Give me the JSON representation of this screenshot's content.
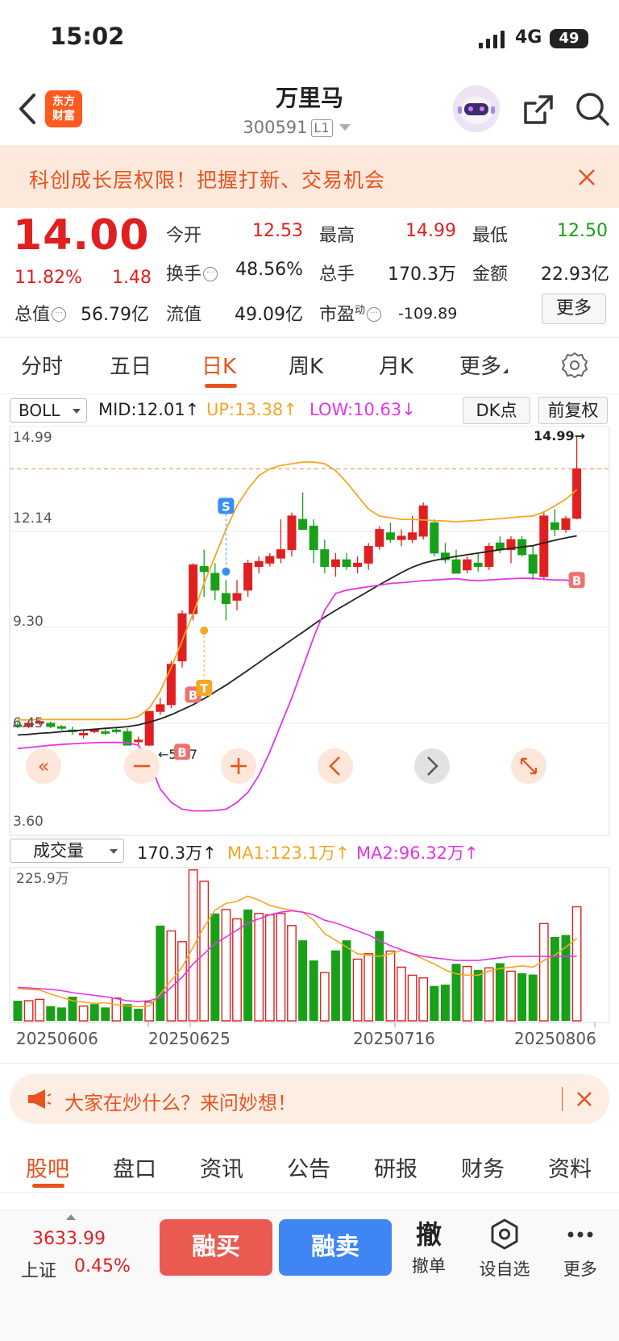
{
  "status_bar": {
    "time": "15:02",
    "network": "4G",
    "battery": "49"
  },
  "header": {
    "logo_text": [
      "东方",
      "财富"
    ],
    "stock_name": "万里马",
    "stock_code": "300591",
    "level_badge": "L1"
  },
  "promo": {
    "text": "科创成长层权限！把握打新、交易机会"
  },
  "quote": {
    "price": "14.00",
    "change_pct": "11.82%",
    "change_amt": "1.48",
    "open_label": "今开",
    "open": "12.53",
    "high_label": "最高",
    "high": "14.99",
    "low_label": "最低",
    "low": "12.50",
    "turnover_label": "换手",
    "turnover": "48.56%",
    "volume_label": "总手",
    "volume": "170.3万",
    "amount_label": "金额",
    "amount": "22.93亿",
    "total_cap_label": "总值",
    "total_cap": "56.79亿",
    "float_cap_label": "流值",
    "float_cap": "49.09亿",
    "pe_label": "市盈",
    "pe_sup": "动",
    "pe": "-109.89",
    "more_label": "更多"
  },
  "period_tabs": [
    "分时",
    "五日",
    "日K",
    "周K",
    "月K",
    "更多"
  ],
  "indicator": {
    "name": "BOLL",
    "mid": "MID:12.01↑",
    "up": "UP:13.38↑",
    "low": "LOW:10.63↓",
    "dk_label": "DK点",
    "adjust_label": "前复权"
  },
  "colors": {
    "up": "#e02020",
    "down": "#19a019",
    "boll_mid": "#222222",
    "boll_up": "#f5a623",
    "boll_low": "#e535e5",
    "accent": "#e8531f"
  },
  "chart_data": [
    {
      "type": "candlestick",
      "y_axis_labels": [
        "14.99",
        "12.14",
        "9.30",
        "6.45",
        "3.60"
      ],
      "ylim": [
        3.6,
        14.99
      ],
      "high_marker": "14.99",
      "low_marker": "5.77",
      "signals": [
        "S",
        "B",
        "T",
        "B",
        "B"
      ],
      "candles": [
        [
          6.4,
          6.48,
          6.3,
          6.35
        ],
        [
          6.35,
          6.55,
          6.3,
          6.45
        ],
        [
          6.45,
          6.55,
          6.4,
          6.5
        ],
        [
          6.45,
          6.5,
          6.3,
          6.35
        ],
        [
          6.35,
          6.4,
          6.25,
          6.3
        ],
        [
          6.25,
          6.35,
          6.1,
          6.2
        ],
        [
          6.1,
          6.25,
          6.0,
          6.15
        ],
        [
          6.2,
          6.3,
          6.15,
          6.25
        ],
        [
          6.2,
          6.3,
          6.1,
          6.15
        ],
        [
          6.25,
          6.3,
          6.15,
          6.2
        ],
        [
          6.2,
          6.3,
          5.9,
          5.8
        ],
        [
          5.9,
          6.05,
          5.8,
          5.95
        ],
        [
          5.8,
          6.8,
          5.77,
          6.8
        ],
        [
          6.8,
          7.2,
          6.7,
          7.0
        ],
        [
          7.0,
          8.3,
          6.9,
          8.2
        ],
        [
          8.3,
          9.8,
          8.1,
          9.7
        ],
        [
          9.7,
          11.2,
          9.5,
          11.15
        ],
        [
          11.1,
          11.6,
          10.2,
          10.95
        ],
        [
          10.9,
          11.2,
          10.1,
          10.4
        ],
        [
          10.3,
          10.7,
          9.5,
          10.0
        ],
        [
          10.1,
          10.7,
          9.8,
          10.3
        ],
        [
          10.4,
          11.3,
          10.2,
          11.2
        ],
        [
          11.1,
          11.4,
          10.9,
          11.25
        ],
        [
          11.2,
          11.5,
          11.1,
          11.4
        ],
        [
          11.35,
          12.5,
          11.2,
          11.6
        ],
        [
          11.6,
          12.7,
          11.4,
          12.6
        ],
        [
          12.5,
          13.3,
          12.3,
          12.2
        ],
        [
          12.3,
          12.5,
          11.2,
          11.6
        ],
        [
          11.6,
          11.9,
          10.9,
          11.1
        ],
        [
          11.1,
          11.5,
          10.8,
          11.3
        ],
        [
          11.3,
          11.5,
          11.0,
          11.1
        ],
        [
          11.1,
          11.4,
          10.9,
          11.2
        ],
        [
          11.2,
          11.8,
          11.0,
          11.7
        ],
        [
          11.7,
          12.3,
          11.6,
          12.2
        ],
        [
          12.1,
          12.4,
          11.8,
          11.9
        ],
        [
          11.9,
          12.2,
          11.7,
          12.0
        ],
        [
          11.9,
          12.6,
          11.8,
          12.1
        ],
        [
          12.0,
          13.0,
          11.9,
          12.9
        ],
        [
          12.4,
          12.5,
          11.4,
          11.5
        ],
        [
          11.5,
          11.8,
          11.2,
          11.3
        ],
        [
          11.3,
          11.6,
          10.9,
          10.9
        ],
        [
          11.0,
          11.4,
          10.9,
          11.3
        ],
        [
          11.2,
          11.5,
          10.95,
          11.1
        ],
        [
          11.1,
          11.8,
          11.0,
          11.7
        ],
        [
          11.8,
          12.0,
          11.5,
          11.6
        ],
        [
          11.6,
          12.0,
          11.2,
          11.9
        ],
        [
          11.9,
          12.0,
          11.4,
          11.45
        ],
        [
          11.45,
          11.7,
          10.7,
          10.9
        ],
        [
          10.8,
          12.7,
          10.7,
          12.6
        ],
        [
          12.4,
          12.8,
          12.0,
          12.2
        ],
        [
          12.2,
          12.6,
          12.1,
          12.52
        ],
        [
          12.53,
          14.99,
          12.5,
          14.0
        ]
      ],
      "boll_mid": [
        6.1,
        6.12,
        6.15,
        6.17,
        6.2,
        6.22,
        6.25,
        6.27,
        6.3,
        6.32,
        6.35,
        6.4,
        6.48,
        6.58,
        6.7,
        6.85,
        7.0,
        7.18,
        7.38,
        7.58,
        7.8,
        8.02,
        8.25,
        8.48,
        8.7,
        8.93,
        9.15,
        9.38,
        9.6,
        9.8,
        9.99,
        10.18,
        10.37,
        10.56,
        10.74,
        10.92,
        11.08,
        11.2,
        11.28,
        11.34,
        11.4,
        11.45,
        11.5,
        11.55,
        11.6,
        11.64,
        11.68,
        11.72,
        11.8,
        11.88,
        11.95,
        12.01
      ],
      "boll_up": [
        6.55,
        6.55,
        6.56,
        6.56,
        6.56,
        6.56,
        6.56,
        6.56,
        6.56,
        6.56,
        6.57,
        6.65,
        6.9,
        7.4,
        8.1,
        8.9,
        9.7,
        10.6,
        11.4,
        12.2,
        12.9,
        13.4,
        13.8,
        14.0,
        14.1,
        14.15,
        14.2,
        14.2,
        14.15,
        13.95,
        13.6,
        13.2,
        12.8,
        12.6,
        12.55,
        12.5,
        12.5,
        12.48,
        12.46,
        12.45,
        12.43,
        12.45,
        12.47,
        12.5,
        12.52,
        12.55,
        12.58,
        12.6,
        12.72,
        12.9,
        13.1,
        13.38
      ],
      "boll_low": [
        5.7,
        5.73,
        5.76,
        5.8,
        5.82,
        5.84,
        5.86,
        5.87,
        5.88,
        5.88,
        5.87,
        5.8,
        5.3,
        4.5,
        4.1,
        3.9,
        3.85,
        3.85,
        3.86,
        3.9,
        4.1,
        4.4,
        4.9,
        5.6,
        6.4,
        7.2,
        8.1,
        9.0,
        9.8,
        10.3,
        10.4,
        10.45,
        10.5,
        10.55,
        10.6,
        10.62,
        10.65,
        10.68,
        10.7,
        10.72,
        10.74,
        10.7,
        10.68,
        10.7,
        10.72,
        10.74,
        10.75,
        10.75,
        10.72,
        10.7,
        10.7,
        10.63
      ]
    },
    {
      "type": "bar",
      "name": "成交量",
      "max_label": "225.9万",
      "ylim": [
        0,
        225.9
      ],
      "value_label": "170.3万↑",
      "ma1_label": "MA1:123.1万↑",
      "ma2_label": "MA2:96.32万↑",
      "x_labels": [
        "20250606",
        "20250625",
        "20250716",
        "20250806"
      ],
      "volume": [
        30,
        30,
        32,
        22,
        20,
        36,
        22,
        25,
        20,
        34,
        25,
        18,
        28,
        142,
        134,
        118,
        225,
        208,
        160,
        166,
        152,
        166,
        160,
        158,
        160,
        142,
        120,
        90,
        72,
        105,
        120,
        92,
        100,
        134,
        104,
        80,
        68,
        64,
        52,
        54,
        85,
        81,
        76,
        79,
        86,
        74,
        71,
        69,
        145,
        125,
        128,
        170
      ],
      "volume_up": [
        0,
        1,
        1,
        0,
        0,
        0,
        1,
        0,
        0,
        1,
        0,
        0,
        1,
        0,
        1,
        1,
        1,
        1,
        0,
        1,
        1,
        0,
        1,
        1,
        1,
        1,
        0,
        0,
        1,
        0,
        0,
        1,
        1,
        0,
        1,
        1,
        1,
        1,
        0,
        0,
        0,
        1,
        0,
        1,
        0,
        1,
        0,
        0,
        1,
        0,
        0,
        1
      ],
      "ma1": [
        48,
        47,
        46,
        40,
        35,
        30,
        28,
        26,
        27,
        24,
        22,
        21,
        22,
        40,
        60,
        80,
        110,
        140,
        165,
        175,
        178,
        186,
        180,
        172,
        168,
        165,
        162,
        150,
        130,
        120,
        110,
        100,
        98,
        96,
        100,
        105,
        100,
        92,
        85,
        76,
        70,
        68,
        68,
        74,
        78,
        80,
        82,
        80,
        90,
        98,
        110,
        123.1
      ],
      "ma2": [
        50,
        49,
        48,
        47,
        45,
        42,
        40,
        38,
        36,
        33,
        30,
        29,
        30,
        35,
        50,
        65,
        85,
        100,
        115,
        125,
        135,
        146,
        152,
        158,
        162,
        164,
        162,
        158,
        150,
        146,
        140,
        134,
        128,
        120,
        112,
        106,
        100,
        96,
        94,
        92,
        90,
        90,
        90,
        92,
        94,
        96,
        96,
        96,
        96,
        96,
        96,
        96.32
      ]
    }
  ],
  "news_banner": {
    "text": "大家在炒什么？来问妙想！"
  },
  "bottom_tabs": [
    "股吧",
    "盘口",
    "资讯",
    "公告",
    "研报",
    "财务",
    "资料"
  ],
  "bottom_bar": {
    "index_value": "3633.99",
    "index_name": "上证",
    "index_pct": "0.45%",
    "buy_label": "融买",
    "sell_label": "融卖",
    "cancel_label": "撤单",
    "cancel_glyph": "撤",
    "watchlist_label": "设自选",
    "more_label": "更多"
  }
}
